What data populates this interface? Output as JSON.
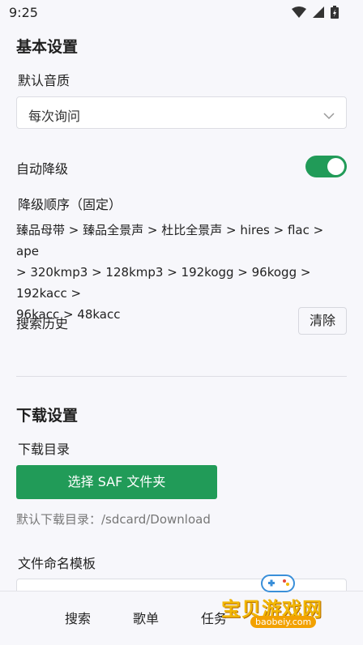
{
  "status_bar": {
    "time": "9:25"
  },
  "basic": {
    "title": "基本设置",
    "quality_label": "默认音质",
    "quality_value": "每次询问",
    "auto_downgrade_label": "自动降级",
    "auto_downgrade_on": true,
    "order_label": "降级顺序（固定）",
    "order_line1": "臻品母带 > 臻品全景声 > 杜比全景声 > hires > flac > ape",
    "order_line2": "> 320kmp3 > 128kmp3 > 192kogg > 96kogg > 192kacc >",
    "order_line3": "96kacc > 48kacc",
    "search_history_label": "搜索历史",
    "clear_label": "清除"
  },
  "download": {
    "title": "下载设置",
    "dir_label": "下载目录",
    "saf_button": "选择 SAF 文件夹",
    "default_dir_hint": "默认下载目录：/sdcard/Download",
    "naming_label": "文件命名模板"
  },
  "bottom_nav": {
    "items": [
      {
        "label": "搜索"
      },
      {
        "label": "歌单"
      },
      {
        "label": "任务"
      }
    ]
  },
  "watermark": {
    "text": "宝贝游戏网",
    "url": "baobeiy.com"
  },
  "colors": {
    "accent": "#219b58",
    "background": "#f7f7fb",
    "watermark": "#f2b705"
  }
}
